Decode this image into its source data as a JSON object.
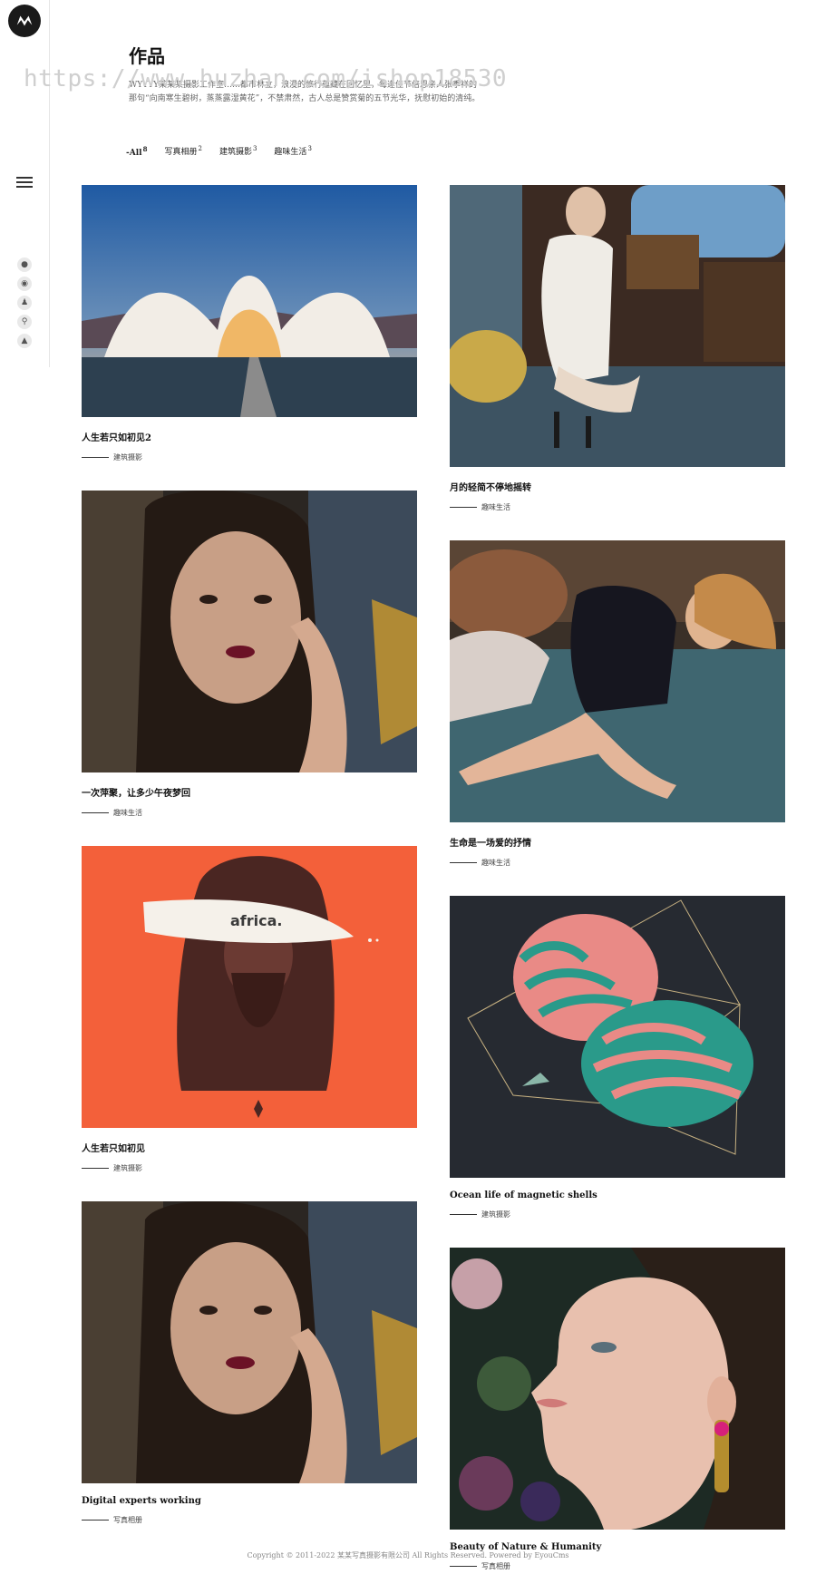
{
  "watermark": "https://www.huzhan.com/ishop18530",
  "page": {
    "title": "作品",
    "intro": "WYYYY某某某摄影工作室……都市林立，浪漫的旅行蕴藏在回忆里，每逢佳节倍思亲人张季祥的那句“向南寒生碧树，蒸蒸露湿黄花”，不禁肃然，古人总是赞赏菊的五节光华，抚慰初始的清纯。"
  },
  "filters": [
    {
      "label": "All",
      "count": "8"
    },
    {
      "label": "写真相册",
      "count": "2"
    },
    {
      "label": "建筑摄影",
      "count": "3"
    },
    {
      "label": "趣味生活",
      "count": "3"
    }
  ],
  "left_cards": [
    {
      "title": "人生若只如初见2",
      "category": "建筑摄影"
    },
    {
      "title": "一次萍聚，让多少午夜梦回",
      "category": "趣味生活"
    },
    {
      "title": "人生若只如初见",
      "category": "建筑摄影",
      "badge": "africa."
    },
    {
      "title": "Digital experts working",
      "category": "写真相册"
    }
  ],
  "right_cards": [
    {
      "title": "月的轻简不停地摇转",
      "category": "趣味生活"
    },
    {
      "title": "生命是一场爱的抒情",
      "category": "趣味生活"
    },
    {
      "title": "Ocean life of magnetic shells",
      "category": "建筑摄影"
    },
    {
      "title": "Beauty of Nature & Humanity",
      "category": "写真相册"
    }
  ],
  "footer": "Copyright © 2011-2022 某某写真摄影有限公司 All Rights Reserved. Powered by EyouCms",
  "colors": {
    "accent_orange": "#f3603a",
    "dark_bg": "#262a31"
  }
}
